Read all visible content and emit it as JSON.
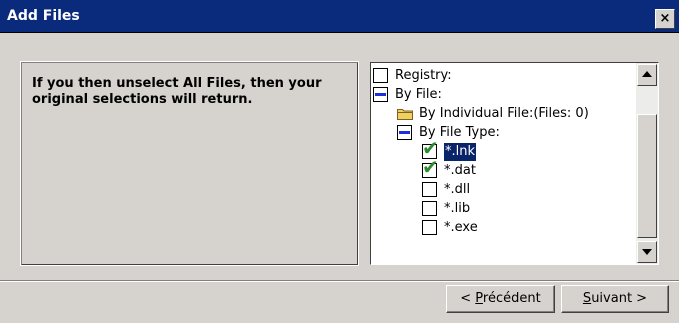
{
  "window": {
    "title": "Add Files",
    "close_glyph": "×"
  },
  "info": {
    "text": "If you then unselect All Files, then your original selections will return."
  },
  "tree": {
    "items": [
      {
        "label": "Registry:",
        "state": "unchecked"
      },
      {
        "label": "By File:",
        "state": "partial"
      },
      {
        "label": "By Individual File:(Files:   0)",
        "icon": "folder-icon"
      },
      {
        "label": "By File Type:",
        "state": "partial"
      },
      {
        "label": "*.lnk",
        "state": "checked",
        "selected": true
      },
      {
        "label": "*.dat",
        "state": "checked"
      },
      {
        "label": "*.dll",
        "state": "unchecked"
      },
      {
        "label": "*.lib",
        "state": "unchecked"
      },
      {
        "label": "*.exe",
        "state": "unchecked"
      }
    ]
  },
  "buttons": {
    "prev": {
      "prefix": "< ",
      "mnemonic": "P",
      "rest": "récédent"
    },
    "next": {
      "prefix": "",
      "mnemonic": "S",
      "rest": "uivant >"
    }
  },
  "colors": {
    "titlebar": "#0a2a7c",
    "dialog_bg": "#d6d3ce",
    "partial_mark": "#1c2fd8",
    "check_mark": "#2d8a2d",
    "selection": "#0a246a"
  }
}
